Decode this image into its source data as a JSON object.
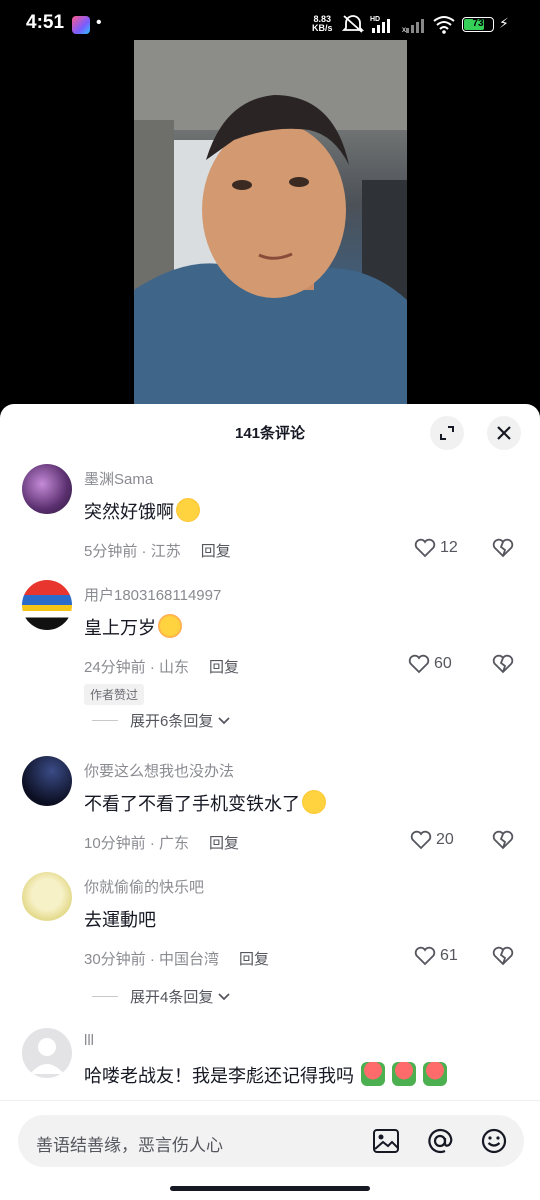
{
  "status": {
    "time": "4:51",
    "net_speed_value": "8.83",
    "net_speed_unit": "KB/s",
    "battery": "73",
    "battery_level": 0.73,
    "icons": [
      "gallery-app-icon",
      "mute-vibrate-icon",
      "hd-signal-icon",
      "signal-icon",
      "wifi-icon",
      "battery-icon",
      "charging-icon"
    ]
  },
  "sheet": {
    "title": "141条评论"
  },
  "comments": [
    {
      "name": "墨渊Sama",
      "text": "突然好饿啊",
      "emoji": "rofl-emoji",
      "time": "5分钟前",
      "location": "江苏",
      "reply": "回复",
      "likes": "12"
    },
    {
      "name": "用户1803168114997",
      "text": "皇上万岁",
      "emoji": "finger-heart-emoji",
      "time": "24分钟前",
      "location": "山东",
      "reply": "回复",
      "likes": "60",
      "badge": "作者赞过",
      "expand": "展开6条回复"
    },
    {
      "name": "你要这么想我也没办法",
      "text": "不看了不看了手机变铁水了",
      "emoji": "crying-emoji",
      "time": "10分钟前",
      "location": "广东",
      "reply": "回复",
      "likes": "20"
    },
    {
      "name": "你就偷偷的快乐吧",
      "text": "去運動吧",
      "time": "30分钟前",
      "location": "中国台湾",
      "reply": "回复",
      "likes": "61",
      "expand": "展开4条回复"
    },
    {
      "name": "lll",
      "text": "哈喽老战友！我是李彪还记得我吗",
      "emoji": "rose-emoji"
    }
  ],
  "input": {
    "placeholder": "善语结善缘，恶言伤人心"
  },
  "colors": {
    "text_primary": "#161823",
    "text_secondary": "#8a8b91",
    "sheet_bg": "#ffffff",
    "battery_green": "#34d058"
  }
}
